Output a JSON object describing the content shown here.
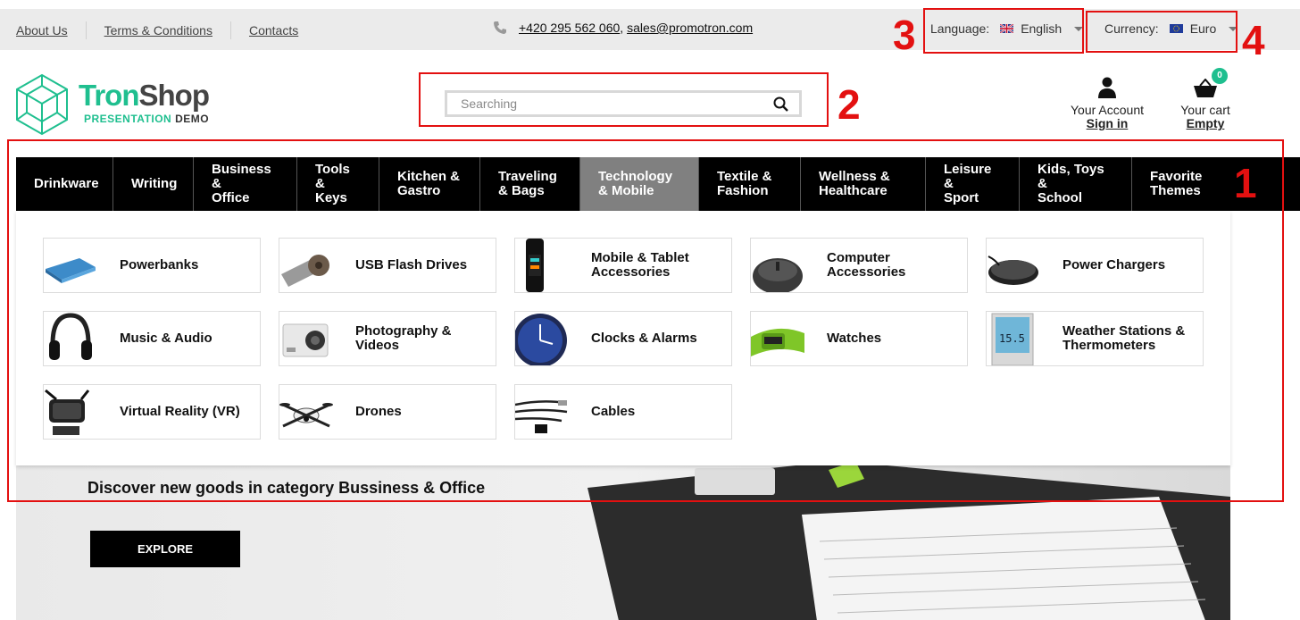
{
  "topbar": {
    "links": [
      "About Us",
      "Terms & Conditions",
      "Contacts"
    ],
    "phone": "+420 295 562 060",
    "email": "sales@promotron.com",
    "language_label": "Language:",
    "language_value": "English",
    "currency_label": "Currency:",
    "currency_value": "Euro"
  },
  "header": {
    "logo_part1": "Tron",
    "logo_part2": "Shop",
    "logo_sub1": "PRESENTATION",
    "logo_sub2": "DEMO",
    "search_placeholder": "Searching",
    "account_label": "Your Account",
    "account_link": "Sign in",
    "cart_label": "Your cart",
    "cart_link": "Empty",
    "cart_count": "0"
  },
  "nav": {
    "items": [
      {
        "line1": "Drinkware",
        "line2": ""
      },
      {
        "line1": "Writing",
        "line2": ""
      },
      {
        "line1": "Business &",
        "line2": "Office"
      },
      {
        "line1": "Tools &",
        "line2": "Keys"
      },
      {
        "line1": "Kitchen &",
        "line2": "Gastro"
      },
      {
        "line1": "Traveling",
        "line2": "& Bags"
      },
      {
        "line1": "Technology",
        "line2": "& Mobile"
      },
      {
        "line1": "Textile &",
        "line2": "Fashion"
      },
      {
        "line1": "Wellness &",
        "line2": "Healthcare"
      },
      {
        "line1": "Leisure &",
        "line2": "Sport"
      },
      {
        "line1": "Kids, Toys &",
        "line2": "School"
      },
      {
        "line1": "Favorite",
        "line2": "Themes"
      }
    ],
    "active_index": 6
  },
  "dropdown": {
    "categories": [
      {
        "l1": "Powerbanks",
        "l2": "",
        "icon": "powerbank-icon"
      },
      {
        "l1": "USB Flash Drives",
        "l2": "",
        "icon": "usb-drive-icon"
      },
      {
        "l1": "Mobile & Tablet",
        "l2": "Accessories",
        "icon": "fitness-band-icon"
      },
      {
        "l1": "Computer",
        "l2": "Accessories",
        "icon": "mouse-icon"
      },
      {
        "l1": "Power Chargers",
        "l2": "",
        "icon": "wireless-charger-icon"
      },
      {
        "l1": "Music & Audio",
        "l2": "",
        "icon": "headphones-icon"
      },
      {
        "l1": "Photography &",
        "l2": "Videos",
        "icon": "camera-icon"
      },
      {
        "l1": "Clocks & Alarms",
        "l2": "",
        "icon": "clock-icon"
      },
      {
        "l1": "Watches",
        "l2": "",
        "icon": "watch-icon"
      },
      {
        "l1": "Weather Stations &",
        "l2": "Thermometers",
        "icon": "weather-station-icon"
      },
      {
        "l1": "Virtual Reality (VR)",
        "l2": "",
        "icon": "vr-headset-icon"
      },
      {
        "l1": "Drones",
        "l2": "",
        "icon": "drone-icon"
      },
      {
        "l1": "Cables",
        "l2": "",
        "icon": "cable-icon"
      }
    ]
  },
  "hero": {
    "title": "Discover new goods in category Bussiness & Office",
    "button": "EXPLORE"
  },
  "annotations": [
    "1",
    "2",
    "3",
    "4"
  ],
  "colors": {
    "accent": "#1fbf8f",
    "annotation": "#e31010",
    "nav_bg": "#000000",
    "nav_active": "#808080"
  }
}
